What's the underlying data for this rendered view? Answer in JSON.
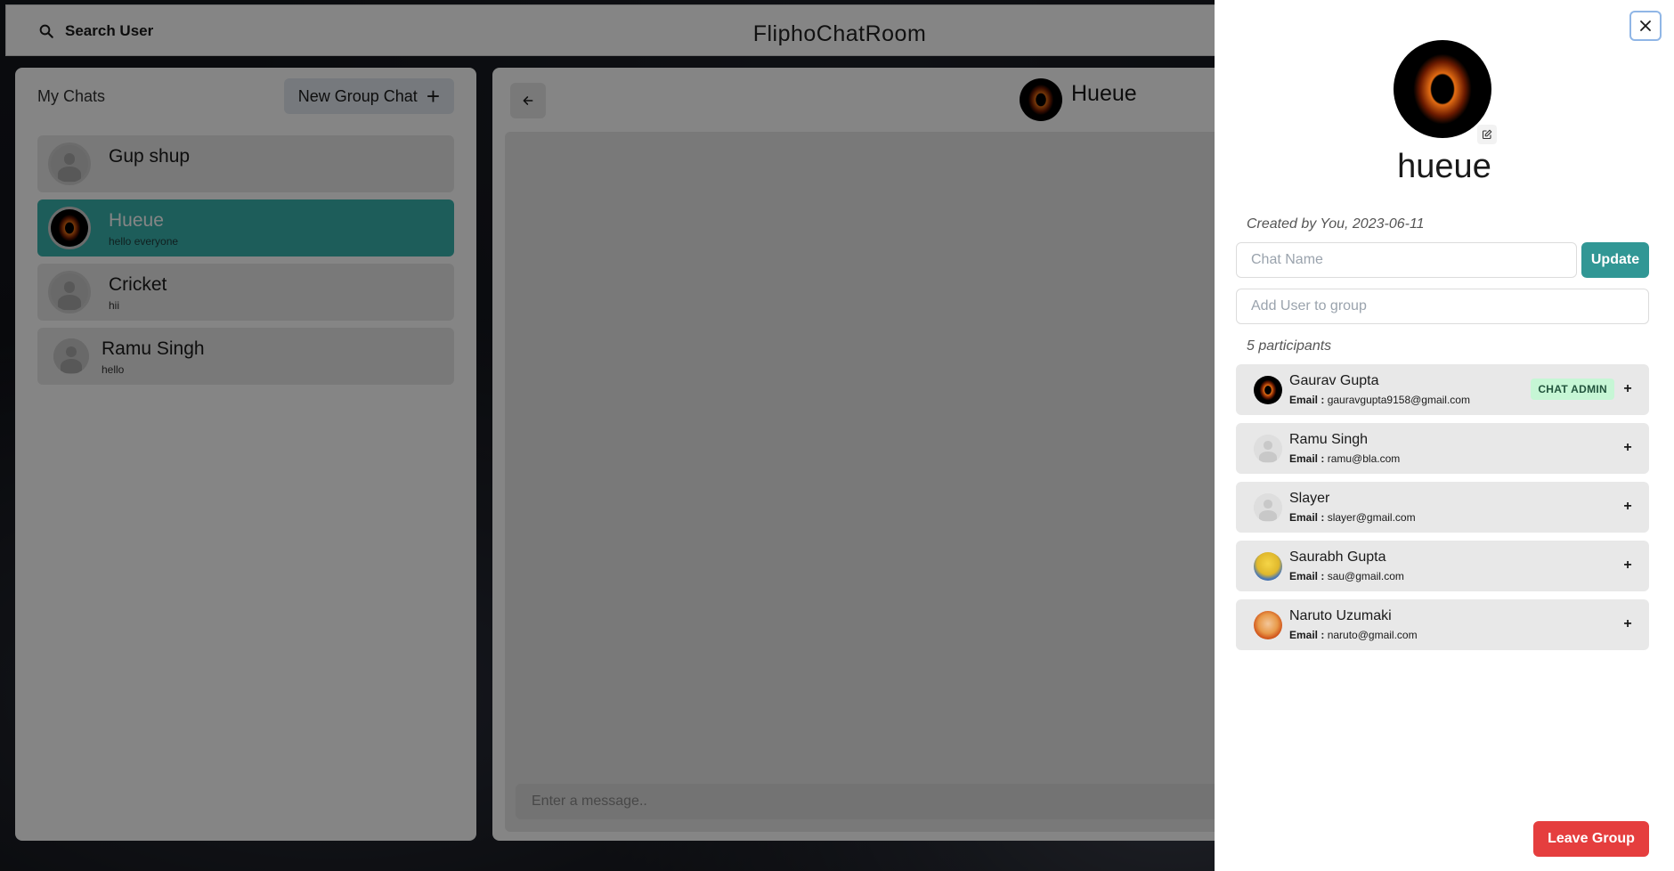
{
  "header": {
    "search_label": "Search User",
    "app_title": "FliphoChatRoom"
  },
  "my_chats": {
    "title": "My Chats",
    "new_group_label": "New Group Chat",
    "items": [
      {
        "name": "Gup shup",
        "preview": "",
        "avatar": "default-user-icon"
      },
      {
        "name": "Hueue",
        "preview": "hello everyone",
        "avatar": "black-hole-image",
        "active": true
      },
      {
        "name": "Cricket",
        "preview": "hii",
        "avatar": "default-user-icon"
      },
      {
        "name": "Ramu Singh",
        "preview": "hello",
        "avatar": "default-user-icon"
      }
    ]
  },
  "chat": {
    "name": "Hueue",
    "message_placeholder": "Enter a message.."
  },
  "group_info": {
    "name": "hueue",
    "created_by": "Created by You, 2023-06-11",
    "chat_name_placeholder": "Chat Name",
    "update_label": "Update",
    "add_user_placeholder": "Add User to group",
    "participants_count": "5 participants",
    "email_label": "Email :",
    "admin_badge": "CHAT ADMIN",
    "remove_symbol": "+",
    "participants": [
      {
        "name": "Gaurav Gupta",
        "email": "gauravgupta9158@gmail.com",
        "admin": true,
        "avatar": "black-hole-image"
      },
      {
        "name": "Ramu Singh",
        "email": "ramu@bla.com",
        "admin": false,
        "avatar": "default-user-icon"
      },
      {
        "name": "Slayer",
        "email": "slayer@gmail.com",
        "admin": false,
        "avatar": "default-user-icon"
      },
      {
        "name": "Saurabh Gupta",
        "email": "sau@gmail.com",
        "admin": false,
        "avatar": "minion-image"
      },
      {
        "name": "Naruto Uzumaki",
        "email": "naruto@gmail.com",
        "admin": false,
        "avatar": "naruto-image"
      }
    ],
    "leave_label": "Leave Group"
  },
  "colors": {
    "accent": "#319795",
    "active_chat": "#38b2ac",
    "danger": "#e53e3e",
    "admin_badge_bg": "#c6f6d5"
  }
}
